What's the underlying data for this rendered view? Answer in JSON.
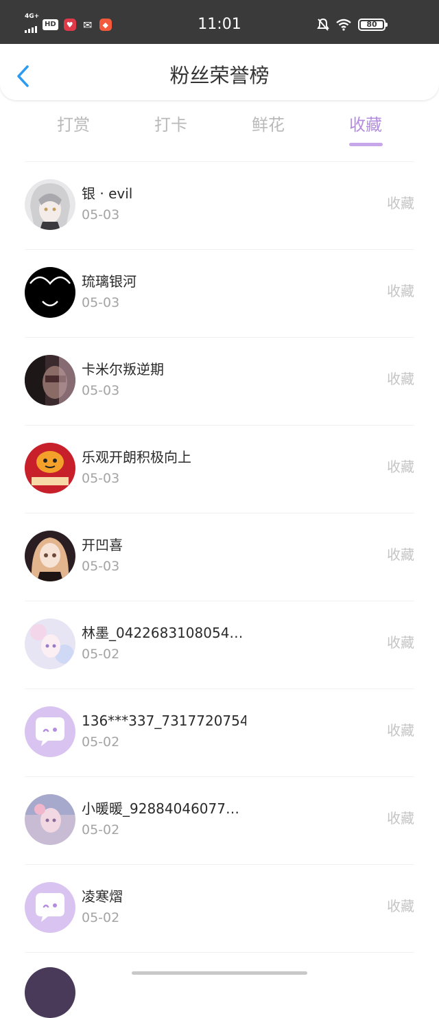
{
  "status_bar": {
    "network": "4G+",
    "hd": "HD",
    "time": "11:01",
    "battery": "80"
  },
  "header": {
    "title": "粉丝荣誉榜"
  },
  "tabs": [
    {
      "label": "打赏",
      "active": false
    },
    {
      "label": "打卡",
      "active": false
    },
    {
      "label": "鲜花",
      "active": false
    },
    {
      "label": "收藏",
      "active": true
    }
  ],
  "accent_color": "#b48de0",
  "fans": [
    {
      "name": "银 · evil",
      "date": "05-03",
      "action": "收藏",
      "avatar": "gray-anime-avatar"
    },
    {
      "name": "琉璃银河",
      "date": "05-03",
      "action": "收藏",
      "avatar": "black-smile-avatar"
    },
    {
      "name": "卡米尔叛逆期",
      "date": "05-03",
      "action": "收藏",
      "avatar": "dark-portrait-avatar"
    },
    {
      "name": "乐观开朗积极向上",
      "date": "05-03",
      "action": "收藏",
      "avatar": "tiger-avatar"
    },
    {
      "name": "开凹喜",
      "date": "05-03",
      "action": "收藏",
      "avatar": "anime-girl-avatar"
    },
    {
      "name": "林墨_0422683108054…",
      "date": "05-02",
      "action": "收藏",
      "avatar": "pastel-anime-avatar"
    },
    {
      "name": "136***337_7317720754",
      "date": "05-02",
      "action": "收藏",
      "avatar": "default-chat-avatar"
    },
    {
      "name": "小暖暖_92884046077…",
      "date": "05-02",
      "action": "收藏",
      "avatar": "pink-anime-avatar"
    },
    {
      "name": "凌寒熠",
      "date": "05-02",
      "action": "收藏",
      "avatar": "default-chat-avatar"
    }
  ]
}
